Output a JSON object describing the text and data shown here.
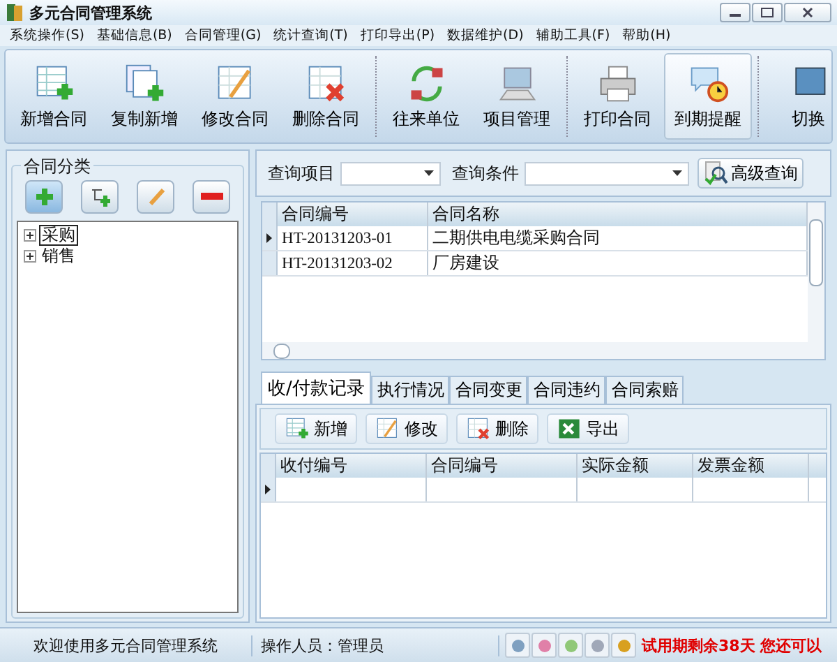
{
  "window": {
    "title": "多元合同管理系统"
  },
  "menu": [
    "系统操作(S)",
    "基础信息(B)",
    "合同管理(G)",
    "统计查询(T)",
    "打印导出(P)",
    "数据维护(D)",
    "辅助工具(F)",
    "帮助(H)"
  ],
  "toolbar": [
    {
      "label": "新增合同",
      "kind": "add",
      "selected": false
    },
    {
      "label": "复制新增",
      "kind": "copy",
      "selected": false
    },
    {
      "label": "修改合同",
      "kind": "edit",
      "selected": false
    },
    {
      "label": "删除合同",
      "kind": "delete",
      "selected": false
    },
    {
      "label": "往来单位",
      "kind": "exchange",
      "selected": false
    },
    {
      "label": "项目管理",
      "kind": "computer",
      "selected": false
    },
    {
      "label": "打印合同",
      "kind": "printer",
      "selected": false
    },
    {
      "label": "到期提醒",
      "kind": "alarm",
      "selected": true
    },
    {
      "label": "切换",
      "kind": "switch",
      "selected": false
    }
  ],
  "category_panel": {
    "title": "合同分类",
    "tree": [
      {
        "label": "采购",
        "selected": true,
        "expanded": false
      },
      {
        "label": "销售",
        "selected": false,
        "expanded": false
      }
    ]
  },
  "query": {
    "fields": [
      {
        "label": "查询项目"
      },
      {
        "label": "查询条件"
      }
    ],
    "advanced_button": "高级查询"
  },
  "contracts": {
    "columns": [
      "合同编号",
      "合同名称"
    ],
    "rows": [
      {
        "cells": [
          "HT-20131203-01",
          "二期供电电缆采购合同"
        ],
        "current": true
      },
      {
        "cells": [
          "HT-20131203-02",
          "厂房建设"
        ],
        "current": false
      }
    ]
  },
  "tabs": [
    {
      "label": "收/付款记录",
      "selected": true
    },
    {
      "label": "执行情况",
      "selected": false
    },
    {
      "label": "合同变更",
      "selected": false
    },
    {
      "label": "合同违约",
      "selected": false
    },
    {
      "label": "合同索赔",
      "selected": false
    }
  ],
  "record_toolbar": [
    {
      "label": "新增",
      "kind": "add"
    },
    {
      "label": "修改",
      "kind": "edit"
    },
    {
      "label": "删除",
      "kind": "delete"
    },
    {
      "label": "导出",
      "kind": "excel"
    }
  ],
  "records": {
    "columns": [
      "收付编号",
      "合同编号",
      "实际金额",
      "发票金额"
    ],
    "rows": [
      {
        "current": true
      }
    ]
  },
  "status_bar": {
    "welcome": "欢迎使用多元合同管理系统",
    "operator": "操作人员：管理员",
    "skins": [
      {
        "color": "#7fa0c0"
      },
      {
        "color": "#e080a8"
      },
      {
        "color": "#90c878"
      },
      {
        "color": "#a0a8b8"
      },
      {
        "color": "#d8a020"
      }
    ],
    "notice": "试用期剩余38天 您还可以"
  }
}
